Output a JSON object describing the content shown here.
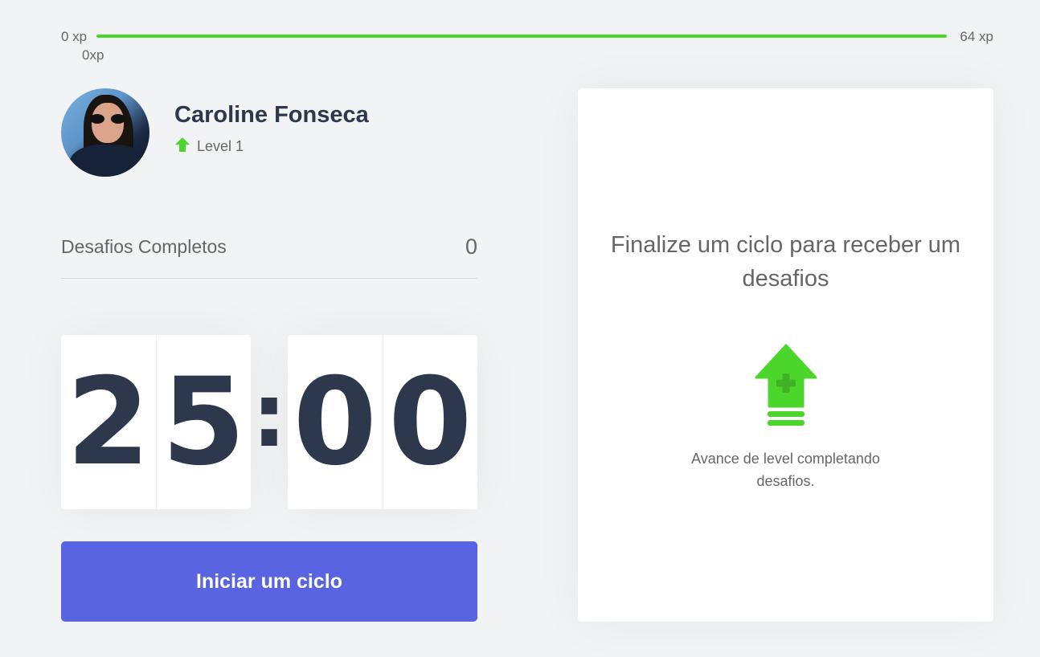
{
  "xp_bar": {
    "min_label": "0 xp",
    "max_label": "64 xp",
    "current_label": "0xp",
    "progress_fraction": 1.0,
    "fill_color": "#4cd62b"
  },
  "profile": {
    "name": "Caroline Fonseca",
    "level_label": "Level 1",
    "level_icon": "level-up-arrow-icon"
  },
  "challenges": {
    "label": "Desafios Completos",
    "count": "0"
  },
  "countdown": {
    "minute_left": "2",
    "minute_right": "5",
    "separator": ":",
    "second_left": "0",
    "second_right": "0"
  },
  "start_button": {
    "label": "Iniciar um ciclo",
    "color": "#5965e0"
  },
  "challenge_box": {
    "title": "Finalize um ciclo para receber um desafios",
    "icon": "level-up-icon",
    "description": "Avance de level completando desafios."
  }
}
